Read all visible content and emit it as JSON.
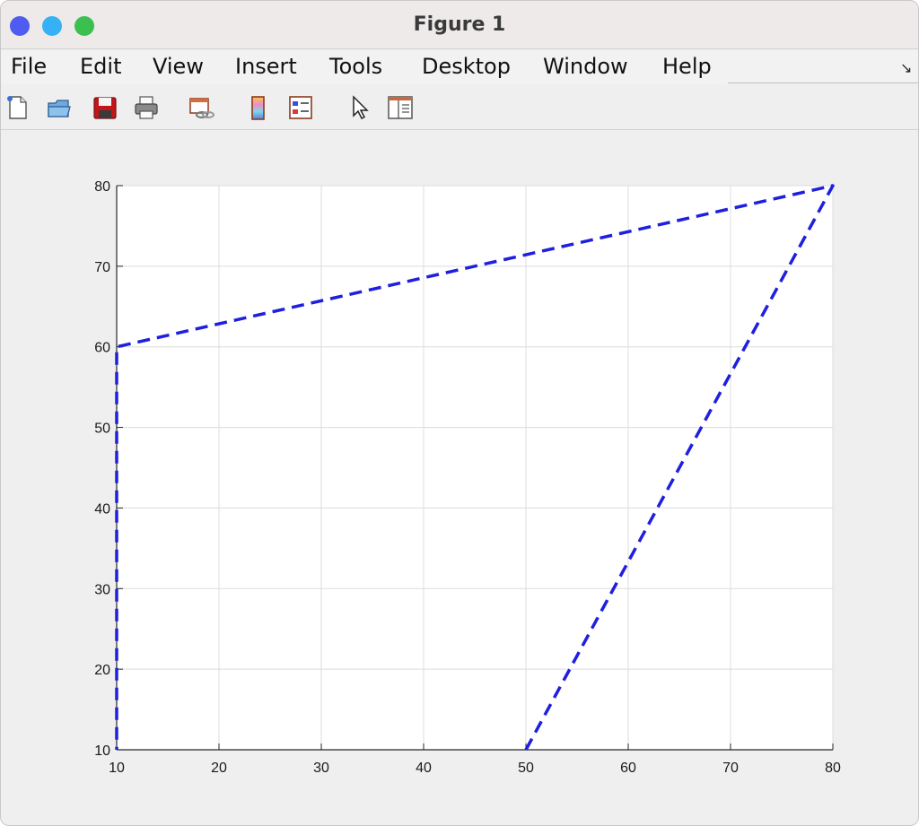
{
  "window": {
    "title": "Figure 1"
  },
  "menu": {
    "items": [
      "File",
      "Edit",
      "View",
      "Insert",
      "Tools",
      "Desktop",
      "Window",
      "Help"
    ]
  },
  "toolbar": {
    "icons": [
      "new-figure-icon",
      "open-file-icon",
      "save-icon",
      "print-icon",
      "link-plot-icon",
      "colorbar-icon",
      "legend-icon",
      "pointer-icon",
      "property-inspector-icon"
    ]
  },
  "chart_data": {
    "type": "line",
    "title": "",
    "xlabel": "",
    "ylabel": "",
    "xlim": [
      10,
      80
    ],
    "ylim": [
      10,
      80
    ],
    "xticks": [
      10,
      20,
      30,
      40,
      50,
      60,
      70,
      80
    ],
    "yticks": [
      10,
      20,
      30,
      40,
      50,
      60,
      70,
      80
    ],
    "grid": true,
    "series": [
      {
        "x": [
          50,
          80,
          10,
          10
        ],
        "y": [
          10,
          80,
          60,
          10
        ],
        "color": "#1f1fdf",
        "linestyle": "dashed"
      }
    ]
  }
}
